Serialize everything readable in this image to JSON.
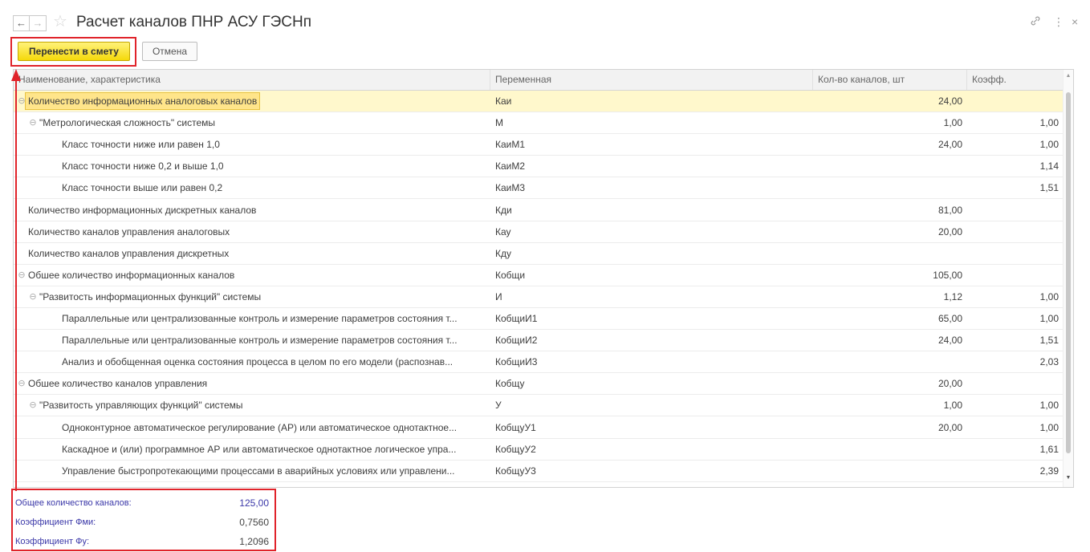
{
  "window": {
    "back_icon": "←",
    "forward_icon": "→",
    "favorite_icon": "☆",
    "title": "Расчет каналов ПНР АСУ ГЭСНп",
    "link_icon": "🔗",
    "more_icon": "⋮",
    "close_icon": "×"
  },
  "toolbar": {
    "transfer_label": "Перенести в смету",
    "cancel_label": "Отмена"
  },
  "table": {
    "headers": [
      "Наименование, характеристика",
      "Переменная",
      "Кол-во каналов, шт",
      "Коэфф."
    ],
    "rows": [
      {
        "name": "Количество информационных аналоговых каналов",
        "var": "Каи",
        "qty": "24,00",
        "coef": "",
        "level": 0,
        "toggle": "⊖",
        "selected": true
      },
      {
        "name": "\"Метрологическая сложность\" системы",
        "var": "М",
        "qty": "1,00",
        "coef": "1,00",
        "level": 1,
        "toggle": "⊖"
      },
      {
        "name": "Класс точности ниже или равен 1,0",
        "var": "КаиМ1",
        "qty": "24,00",
        "coef": "1,00",
        "level": 2,
        "toggle": ""
      },
      {
        "name": "Класс точности ниже 0,2 и выше 1,0",
        "var": "КаиМ2",
        "qty": "",
        "coef": "1,14",
        "level": 2,
        "toggle": ""
      },
      {
        "name": "Класс точности выше или равен 0,2",
        "var": "КаиМ3",
        "qty": "",
        "coef": "1,51",
        "level": 2,
        "toggle": ""
      },
      {
        "name": "Количество информационных дискретных каналов",
        "var": "Кди",
        "qty": "81,00",
        "coef": "",
        "level": 0,
        "toggle": ""
      },
      {
        "name": "Количество каналов управления аналоговых",
        "var": "Кау",
        "qty": "20,00",
        "coef": "",
        "level": 0,
        "toggle": ""
      },
      {
        "name": "Количество каналов управления дискретных",
        "var": "Кду",
        "qty": "",
        "coef": "",
        "level": 0,
        "toggle": ""
      },
      {
        "name": "Обшее количество информационных каналов",
        "var": "Кобщи",
        "qty": "105,00",
        "coef": "",
        "level": 0,
        "toggle": "⊖"
      },
      {
        "name": "\"Развитость информационных функций\" системы",
        "var": "И",
        "qty": "1,12",
        "coef": "1,00",
        "level": 1,
        "toggle": "⊖"
      },
      {
        "name": "Параллельные или централизованные контроль и измерение параметров состояния т...",
        "var": "КобщиИ1",
        "qty": "65,00",
        "coef": "1,00",
        "level": 2,
        "toggle": ""
      },
      {
        "name": "Параллельные или централизованные контроль и измерение параметров состояния т...",
        "var": "КобщиИ2",
        "qty": "24,00",
        "coef": "1,51",
        "level": 2,
        "toggle": ""
      },
      {
        "name": "Анализ и обобщенная оценка состояния процесса в целом по его модели (распознав...",
        "var": "КобщиИ3",
        "qty": "",
        "coef": "2,03",
        "level": 2,
        "toggle": ""
      },
      {
        "name": "Обшее количество каналов управления",
        "var": "Кобщу",
        "qty": "20,00",
        "coef": "",
        "level": 0,
        "toggle": "⊖"
      },
      {
        "name": "\"Развитость управляющих функций\" системы",
        "var": "У",
        "qty": "1,00",
        "coef": "1,00",
        "level": 1,
        "toggle": "⊖"
      },
      {
        "name": "Одноконтурное автоматическое регулирование (АР) или автоматическое однотактное...",
        "var": "КобщуУ1",
        "qty": "20,00",
        "coef": "1,00",
        "level": 2,
        "toggle": ""
      },
      {
        "name": "Каскадное и (или) программное АР или автоматическое однотактное логическое упра...",
        "var": "КобщуУ2",
        "qty": "",
        "coef": "1,61",
        "level": 2,
        "toggle": ""
      },
      {
        "name": "Управление быстропротекающими процессами в аварийных условиях или управлени...",
        "var": "КобщуУ3",
        "qty": "",
        "coef": "2,39",
        "level": 2,
        "toggle": ""
      }
    ]
  },
  "summary": [
    {
      "label": "Общее количество каналов:",
      "value": "125,00"
    },
    {
      "label": "Коэффициент Фми:",
      "value": "0,7560"
    },
    {
      "label": "Коэффициент Фу:",
      "value": "1,2096"
    }
  ],
  "colors": {
    "highlight_frame": "#e0232a",
    "primary_button": "#f5d90a",
    "selected_row": "#fff8cc",
    "summary_label": "#3a37a8"
  }
}
